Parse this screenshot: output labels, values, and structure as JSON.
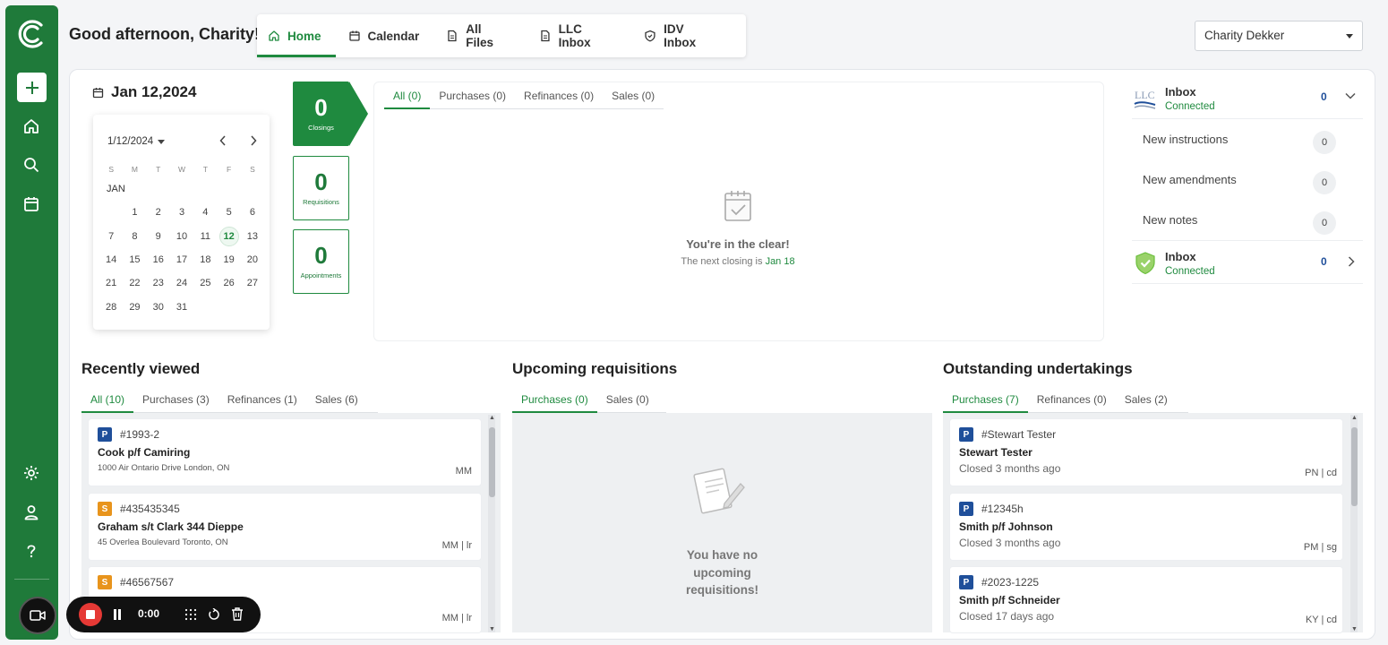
{
  "header": {
    "greeting": "Good afternoon, Charity!",
    "nav": [
      {
        "label": "Home",
        "icon": "home-icon",
        "active": true
      },
      {
        "label": "Calendar",
        "icon": "calendar-icon"
      },
      {
        "label": "All Files",
        "icon": "file-icon"
      },
      {
        "label": "LLC Inbox",
        "icon": "file-icon"
      },
      {
        "label": "IDV Inbox",
        "icon": "shield-icon"
      }
    ],
    "user_select": "Charity Dekker"
  },
  "date_title": "Jan 12,2024",
  "calendar": {
    "month_select": "1/12/2024",
    "dow": [
      "S",
      "M",
      "T",
      "W",
      "T",
      "F",
      "S"
    ],
    "month_label": "JAN",
    "selected": "12",
    "weeks": [
      [
        "",
        "1",
        "2",
        "3",
        "4",
        "5",
        "6"
      ],
      [
        "7",
        "8",
        "9",
        "10",
        "11",
        "12",
        "13"
      ],
      [
        "14",
        "15",
        "16",
        "17",
        "18",
        "19",
        "20"
      ],
      [
        "21",
        "22",
        "23",
        "24",
        "25",
        "26",
        "27"
      ],
      [
        "28",
        "29",
        "30",
        "31",
        "",
        "",
        ""
      ]
    ]
  },
  "stats": [
    {
      "num": "0",
      "label": "Closings"
    },
    {
      "num": "0",
      "label": "Requisitions"
    },
    {
      "num": "0",
      "label": "Appointments"
    }
  ],
  "closings": {
    "tabs": [
      "All (0)",
      "Purchases (0)",
      "Refinances (0)",
      "Sales (0)"
    ],
    "title": "You're in the clear!",
    "sub": "The next closing is",
    "next_date": "Jan 18"
  },
  "inbox": {
    "llc": {
      "logo": "LLC",
      "title": "Inbox",
      "status": "Connected",
      "count": "0"
    },
    "items": [
      {
        "label": "New instructions",
        "count": "0"
      },
      {
        "label": "New amendments",
        "count": "0"
      },
      {
        "label": "New notes",
        "count": "0"
      }
    ],
    "idv": {
      "title": "Inbox",
      "status": "Connected",
      "count": "0"
    }
  },
  "recent": {
    "title": "Recently viewed",
    "tabs": [
      "All (10)",
      "Purchases (3)",
      "Refinances (1)",
      "Sales (6)"
    ],
    "cards": [
      {
        "tag": "P",
        "num": "#1993-2",
        "name": "Cook p/f Camiring",
        "addr": "1000 Air Ontario Drive   London, ON",
        "init": "MM"
      },
      {
        "tag": "S",
        "num": "#435435345",
        "name": "Graham s/t Clark 344 Dieppe",
        "addr": "45 Overlea Boulevard   Toronto, ON",
        "init": "MM | lr"
      },
      {
        "tag": "S",
        "num": "#46567567",
        "name": "",
        "addr": "",
        "init": "MM | lr"
      }
    ]
  },
  "requisitions": {
    "title": "Upcoming requisitions",
    "tabs": [
      "Purchases (0)",
      "Sales (0)"
    ],
    "empty_line1": "You have no",
    "empty_line2": "upcoming",
    "empty_line3": "requisitions!"
  },
  "undertakings": {
    "title": "Outstanding undertakings",
    "tabs": [
      "Purchases (7)",
      "Refinances (0)",
      "Sales (2)"
    ],
    "cards": [
      {
        "tag": "P",
        "num": "#Stewart Tester",
        "name": "Stewart Tester",
        "sub": "Closed 3 months ago",
        "init": "PN | cd"
      },
      {
        "tag": "P",
        "num": "#12345h",
        "name": "Smith p/f Johnson",
        "sub": "Closed 3 months ago",
        "init": "PM | sg"
      },
      {
        "tag": "P",
        "num": "#2023-1225",
        "name": "Smith p/f Schneider",
        "sub": "Closed 17 days ago",
        "init": "KY | cd"
      }
    ]
  },
  "recorder": {
    "time": "0:00"
  },
  "colors": {
    "brand": "#1f7a3a",
    "accent": "#1f8a3f",
    "purchase_tag": "#1f4f9a",
    "sale_tag": "#e8941c",
    "record": "#e53935"
  }
}
